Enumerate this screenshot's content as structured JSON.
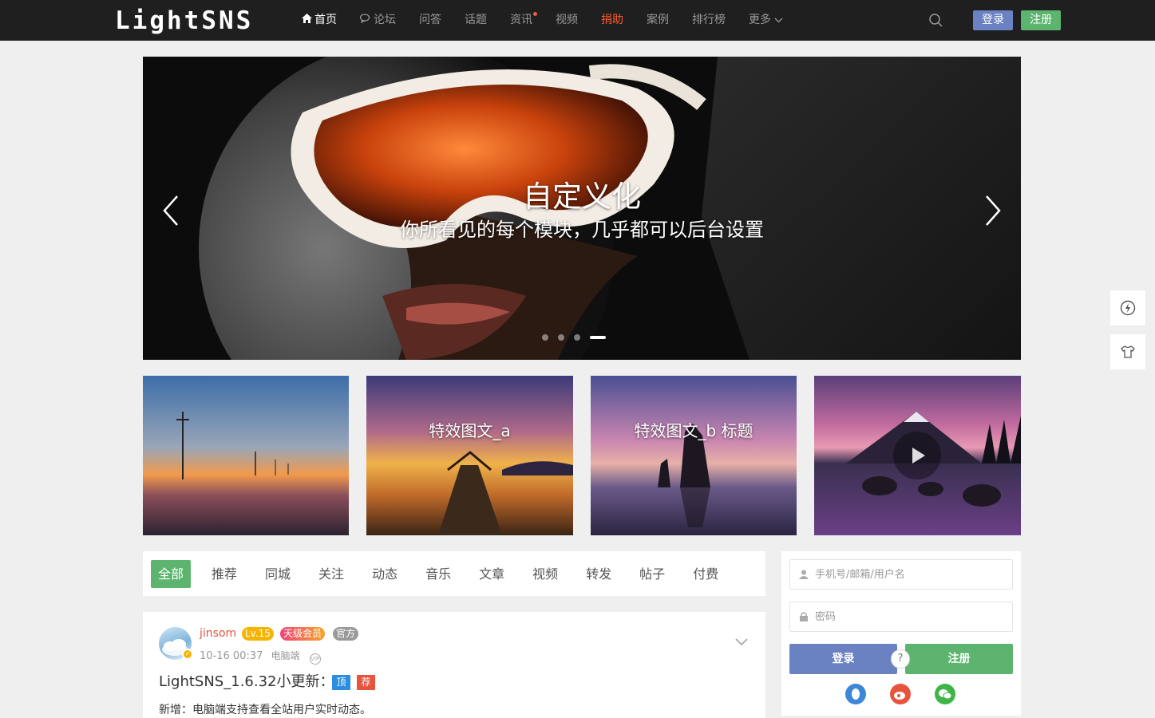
{
  "header": {
    "logo": "LightSNS",
    "nav": [
      {
        "label": "首页",
        "icon": "home-icon",
        "active": true
      },
      {
        "label": "论坛",
        "icon": "comments-icon"
      },
      {
        "label": "问答"
      },
      {
        "label": "话题"
      },
      {
        "label": "资讯",
        "has_dot": true
      },
      {
        "label": "视频"
      },
      {
        "label": "捐助",
        "highlight": true
      },
      {
        "label": "案例"
      },
      {
        "label": "排行榜"
      },
      {
        "label": "更多"
      }
    ],
    "login_label": "登录",
    "register_label": "注册"
  },
  "hero": {
    "title": "自定义化",
    "subtitle": "你所看见的每个模块，几乎都可以后台设置",
    "slide_count": 4,
    "active_slide": 4
  },
  "cards": [
    {
      "label": ""
    },
    {
      "label": "特效图文_a"
    },
    {
      "label": "特效图文_b 标题"
    },
    {
      "label": "",
      "video": true
    }
  ],
  "tabs": [
    "全部",
    "推荐",
    "同城",
    "关注",
    "动态",
    "音乐",
    "文章",
    "视频",
    "转发",
    "帖子",
    "付费"
  ],
  "post": {
    "username": "jinsom",
    "level": "Lv.15",
    "vip": "天级会员",
    "official": "官方",
    "time": "10-16 00:37",
    "device": "电脑端",
    "title": "LightSNS_1.6.32小更新：",
    "tag_top": "顶",
    "tag_rec": "荐",
    "desc": "新增：电脑端支持查看全站用户实时动态。"
  },
  "login_box": {
    "username_placeholder": "手机号/邮箱/用户名",
    "password_placeholder": "密码",
    "login_label": "登录",
    "register_label": "注册",
    "help": "?"
  },
  "colors": {
    "header_bg": "#1f1f1f",
    "accent_green": "#5cb46e",
    "accent_blue": "#6b82c2",
    "donate_red": "#ff5a2b"
  }
}
